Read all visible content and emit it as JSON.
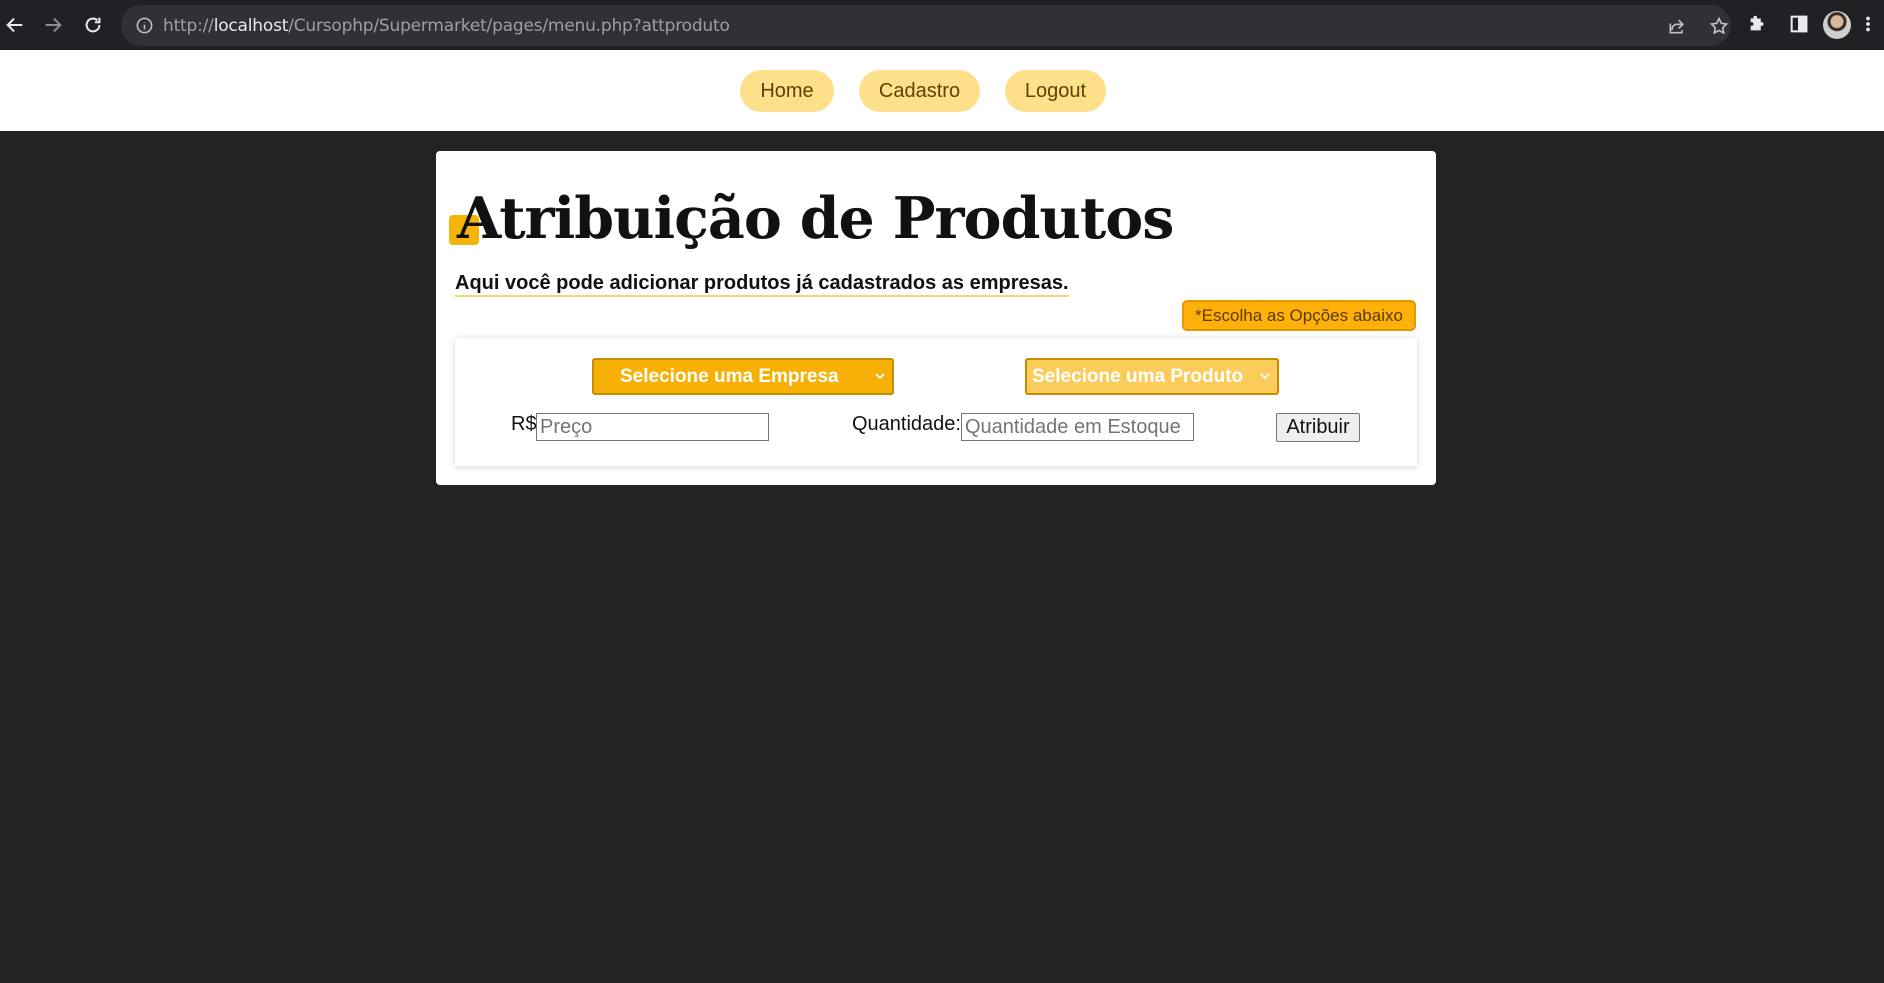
{
  "browser": {
    "url_prefix": "http://",
    "url_host": "localhost",
    "url_path": "/Cursophp/Supermarket/pages/menu.php?attproduto"
  },
  "header": {
    "menu": [
      {
        "label": "Home"
      },
      {
        "label": "Cadastro"
      },
      {
        "label": "Logout"
      }
    ]
  },
  "page": {
    "title": "Atribuição de Produtos",
    "subtitle": "Aqui você pode adicionar produtos já cadastrados as empresas.",
    "hint": "*Escolha as Opções abaixo"
  },
  "form": {
    "empresa_select": "Selecione uma Empresa",
    "produto_select": "Selecione uma Produto",
    "price_label": "R$",
    "price_placeholder": "Preço",
    "quantity_label": "Quantidade:",
    "quantity_placeholder": "Quantidade em Estoque",
    "submit_label": "Atribuir"
  },
  "colors": {
    "accent": "#f7b006",
    "accent_light": "#fbcc5c",
    "menu_bg": "#ffe08a",
    "page_bg": "#232323"
  }
}
